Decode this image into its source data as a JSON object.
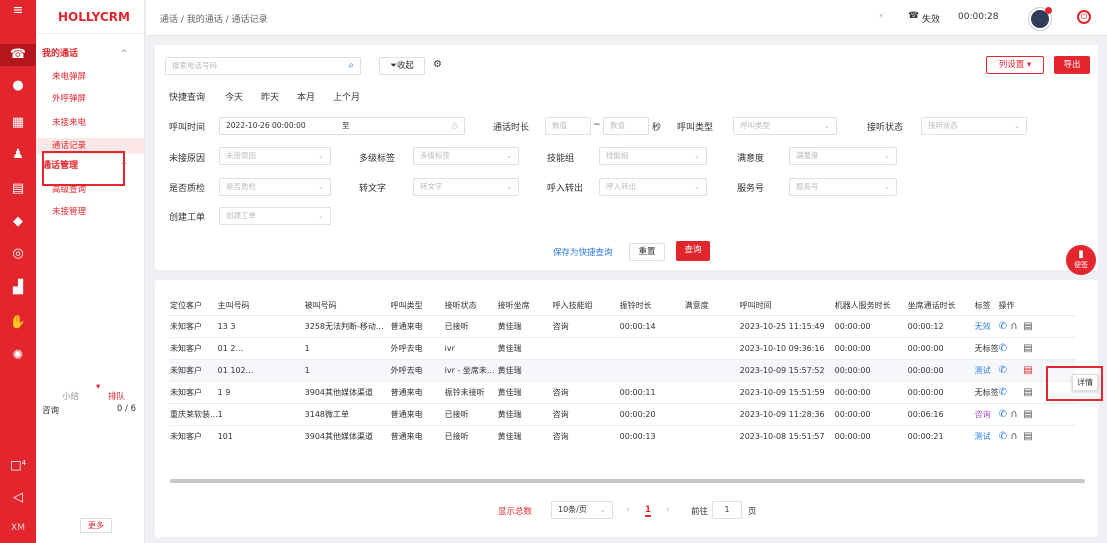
{
  "rail": {
    "icons": [
      "menu-icon",
      "phone-icon",
      "chat-icon",
      "grid-icon",
      "person-icon",
      "document-icon",
      "shield-icon",
      "robot-icon",
      "bar-chart-icon",
      "handshake-icon",
      "gear-icon",
      "notification-icon",
      "collapse-icon"
    ],
    "notify_count": "4",
    "user_initials": "XM"
  },
  "sidebar": {
    "brand": "HOLLYCRM",
    "group1": "我的通话",
    "group1_items": [
      "来电弹屏",
      "外呼弹屏",
      "未接来电",
      "通话记录"
    ],
    "group2": "通话管理",
    "group2_items": [
      "高级查询",
      "未接管理"
    ],
    "queue_label1": "小结",
    "queue_label2": "排队",
    "queue_name": "咨询",
    "queue_count": "0 / 6",
    "more": "更多"
  },
  "topbar": {
    "breadcrumb": "通话 / 我的通话 / 通话记录",
    "status": "失效",
    "timer": "00:00:28"
  },
  "search": {
    "placeholder": "搜索电话号码",
    "collapse": "收起",
    "col_settings": "列设置",
    "export": "导出"
  },
  "quick": {
    "label": "快捷查询",
    "items": [
      "今天",
      "昨天",
      "本月",
      "上个月"
    ]
  },
  "filters": {
    "call_time": "呼叫时间",
    "start": "2022-10-26 00:00:00",
    "to": "至",
    "duration": "通话时长",
    "num": "数值",
    "tilde": "~",
    "sec": "秒",
    "call_type": "呼叫类型",
    "call_type_ph": "呼叫类型",
    "answer_status": "接听状态",
    "answer_status_ph": "接听状态",
    "missed_reason": "未接原因",
    "missed_reason_ph": "未接原因",
    "multi_tag": "多级标签",
    "multi_tag_ph": "多级标签",
    "skill": "技能组",
    "skill_ph": "技能组",
    "satisfaction": "满意度",
    "satisfaction_ph": "满意度",
    "qc": "是否质检",
    "qc_ph": "是否质检",
    "transcript": "转文字",
    "transcript_ph": "转文字",
    "transfer": "呼入转出",
    "transfer_ph": "呼入转出",
    "service_no": "服务号",
    "service_no_ph": "服务号",
    "ticket": "创建工单",
    "ticket_ph": "创建工单"
  },
  "actions": {
    "save_quick": "保存为快捷查询",
    "reset": "重置",
    "query": "查询"
  },
  "table": {
    "headers": [
      "定位客户",
      "主叫号码",
      "被叫号码",
      "呼叫类型",
      "接听状态",
      "接听坐席",
      "呼入技能组",
      "振铃时长",
      "满意度",
      "呼叫时间",
      "机器人服务时长",
      "坐席通话时长",
      "标签",
      "操作"
    ],
    "rows": [
      {
        "cust": "未知客户",
        "caller": "13 3",
        "callee": "3258无法判断-移动...",
        "type": "普通来电",
        "status": "已接听",
        "agent": "黄佳瑞",
        "skill": "咨询",
        "ring": "00:00:14",
        "sat": "",
        "time": "2023-10-25 11:15:49",
        "robot": "00:00:00",
        "talk": "00:00:12",
        "tag": "无效",
        "tagc": "tag-b"
      },
      {
        "cust": "未知客户",
        "caller": "01 2...",
        "callee": "1",
        "type": "外呼去电",
        "status": "ivr",
        "agent": "黄佳瑞",
        "skill": "",
        "ring": "",
        "sat": "",
        "time": "2023-10-10 09:36:16",
        "robot": "00:00:00",
        "talk": "00:00:00",
        "tag": "无标签",
        "tagc": ""
      },
      {
        "cust": "未知客户",
        "caller": "01 102...",
        "callee": "1",
        "type": "外呼去电",
        "status": "ivr - 坐席未...",
        "agent": "黄佳瑞",
        "skill": "",
        "ring": "",
        "sat": "",
        "time": "2023-10-09 15:57:52",
        "robot": "00:00:00",
        "talk": "00:00:00",
        "tag": "测试",
        "tagc": "tag-b"
      },
      {
        "cust": "未知客户",
        "caller": "1 9",
        "callee": "3904其他媒体渠道",
        "type": "普通来电",
        "status": "振铃未接听",
        "agent": "黄佳瑞",
        "skill": "咨询",
        "ring": "00:00:11",
        "sat": "",
        "time": "2023-10-09 15:51:59",
        "robot": "00:00:00",
        "talk": "00:00:00",
        "tag": "无标签",
        "tagc": ""
      },
      {
        "cust": "重庆莱软装...",
        "caller": "1",
        "callee": "3148微工单",
        "type": "普通来电",
        "status": "已接听",
        "agent": "黄佳瑞",
        "skill": "咨询",
        "ring": "00:00:20",
        "sat": "",
        "time": "2023-10-09 11:28:36",
        "robot": "00:00:00",
        "talk": "00:06:16",
        "tag": "咨询",
        "tagc": "tag-p"
      },
      {
        "cust": "未知客户",
        "caller": "101",
        "callee": "3904其他媒体渠道",
        "type": "普通来电",
        "status": "已接听",
        "agent": "黄佳瑞",
        "skill": "咨询",
        "ring": "00:00:13",
        "sat": "",
        "time": "2023-10-08 15:51:57",
        "robot": "00:00:00",
        "talk": "00:00:21",
        "tag": "测试",
        "tagc": "tag-b"
      }
    ],
    "tooltip": "详情"
  },
  "fab": {
    "label": "便签"
  },
  "pagination": {
    "total": "显示总数",
    "size": "10条/页",
    "page": "1",
    "goto": "前往",
    "goto_val": "1",
    "unit": "页"
  }
}
